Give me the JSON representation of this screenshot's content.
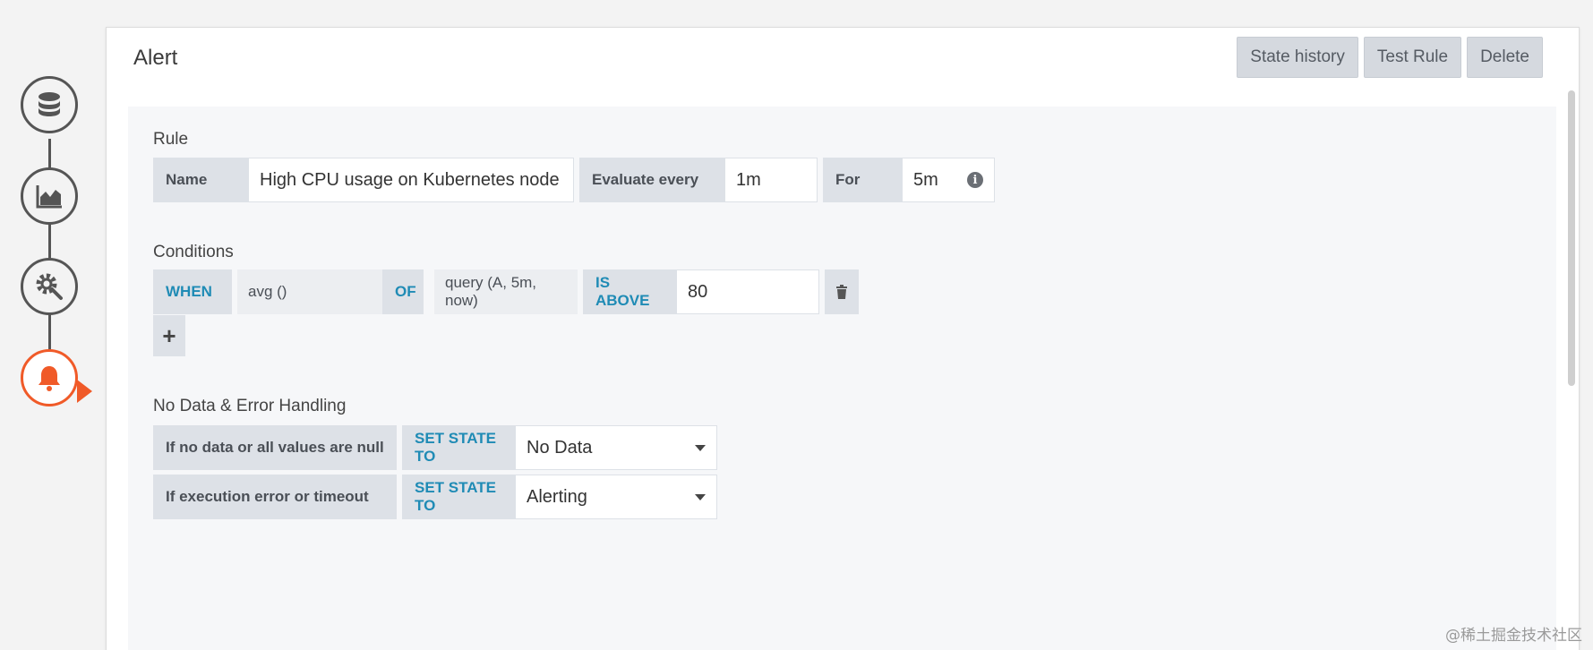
{
  "panel": {
    "title": "Alert",
    "buttons": {
      "state_history": "State history",
      "test_rule": "Test Rule",
      "delete": "Delete"
    }
  },
  "steps": [
    {
      "icon": "database-icon"
    },
    {
      "icon": "area-chart-icon"
    },
    {
      "icon": "settings-icon"
    },
    {
      "icon": "bell-icon",
      "active": true
    }
  ],
  "rule": {
    "title": "Rule",
    "name_label": "Name",
    "name_value": "High CPU usage on Kubernetes node",
    "evaluate_label": "Evaluate every",
    "evaluate_value": "1m",
    "for_label": "For",
    "for_value": "5m",
    "info_glyph": "i"
  },
  "conditions": {
    "title": "Conditions",
    "when": "WHEN",
    "reducer": "avg ()",
    "of": "OF",
    "query": "query (A, 5m, now)",
    "evaluator": "IS ABOVE",
    "threshold": "80",
    "add_glyph": "+"
  },
  "no_data": {
    "title": "No Data & Error Handling",
    "rows": [
      {
        "label": "If no data or all values are null",
        "keyword": "SET STATE TO",
        "value": "No Data"
      },
      {
        "label": "If execution error or timeout",
        "keyword": "SET STATE TO",
        "value": "Alerting"
      }
    ]
  },
  "watermark": "@稀土掘金技术社区",
  "colors": {
    "accent": "#f05a28",
    "keyword": "#1f8bb5",
    "label_bg": "#dde1e7"
  }
}
